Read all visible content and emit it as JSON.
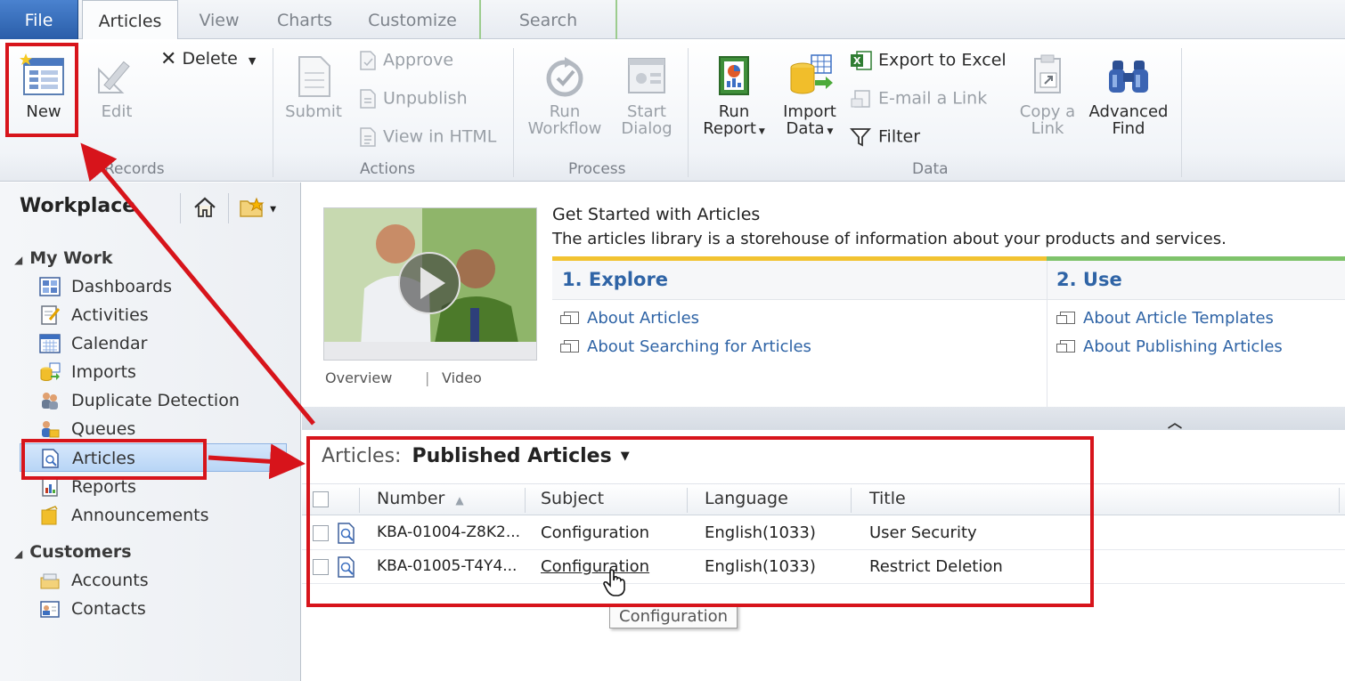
{
  "tabs": {
    "file": "File",
    "articles": "Articles",
    "view": "View",
    "charts": "Charts",
    "customize": "Customize",
    "search": "Search"
  },
  "ribbon": {
    "records": {
      "label": "Records",
      "new": "New",
      "edit": "Edit",
      "delete": "Delete"
    },
    "actions": {
      "label": "Actions",
      "submit": "Submit",
      "approve": "Approve",
      "unpublish": "Unpublish",
      "view_html": "View in HTML"
    },
    "process": {
      "label": "Process",
      "run_workflow_1": "Run",
      "run_workflow_2": "Workflow",
      "start_dialog_1": "Start",
      "start_dialog_2": "Dialog"
    },
    "data": {
      "label": "Data",
      "run_report_1": "Run",
      "run_report_2": "Report",
      "import_data_1": "Import",
      "import_data_2": "Data",
      "export_excel": "Export to Excel",
      "email_link": "E-mail a Link",
      "filter": "Filter",
      "copy_link_1": "Copy a",
      "copy_link_2": "Link",
      "advanced_find_1": "Advanced",
      "advanced_find_2": "Find"
    }
  },
  "nav": {
    "title": "Workplace",
    "groups": {
      "my_work": "My Work",
      "customers": "Customers"
    },
    "items": {
      "dashboards": "Dashboards",
      "activities": "Activities",
      "calendar": "Calendar",
      "imports": "Imports",
      "duplicate_detection": "Duplicate Detection",
      "queues": "Queues",
      "articles": "Articles",
      "reports": "Reports",
      "announcements": "Announcements",
      "accounts": "Accounts",
      "contacts": "Contacts"
    }
  },
  "get_started": {
    "title": "Get Started with Articles",
    "description": "The articles library is a storehouse of information about your products and services.",
    "video_overview": "Overview",
    "video_sep": "|",
    "video_label": "Video",
    "explore": {
      "title": "1. Explore",
      "links": [
        "About Articles",
        "About Searching for Articles"
      ]
    },
    "use": {
      "title": "2. Use",
      "links": [
        "About Article Templates",
        "About Publishing Articles"
      ]
    }
  },
  "grid": {
    "entity": "Articles:",
    "view_name": "Published Articles",
    "columns": [
      "Number",
      "Subject",
      "Language",
      "Title"
    ],
    "rows": [
      {
        "number": "KBA-01004-Z8K2...",
        "subject": "Configuration",
        "language": "English(1033)",
        "title": "User Security"
      },
      {
        "number": "KBA-01005-T4Y4...",
        "subject": "Configuration",
        "language": "English(1033)",
        "title": "Restrict Deletion"
      }
    ],
    "tooltip": "Configuration"
  },
  "colors": {
    "annotation_red": "#d7141b",
    "link_blue": "#2f64a6",
    "file_tab_blue": "#2a5ea9",
    "explore_bar": "#f2c331",
    "use_bar": "#7fc36b"
  }
}
